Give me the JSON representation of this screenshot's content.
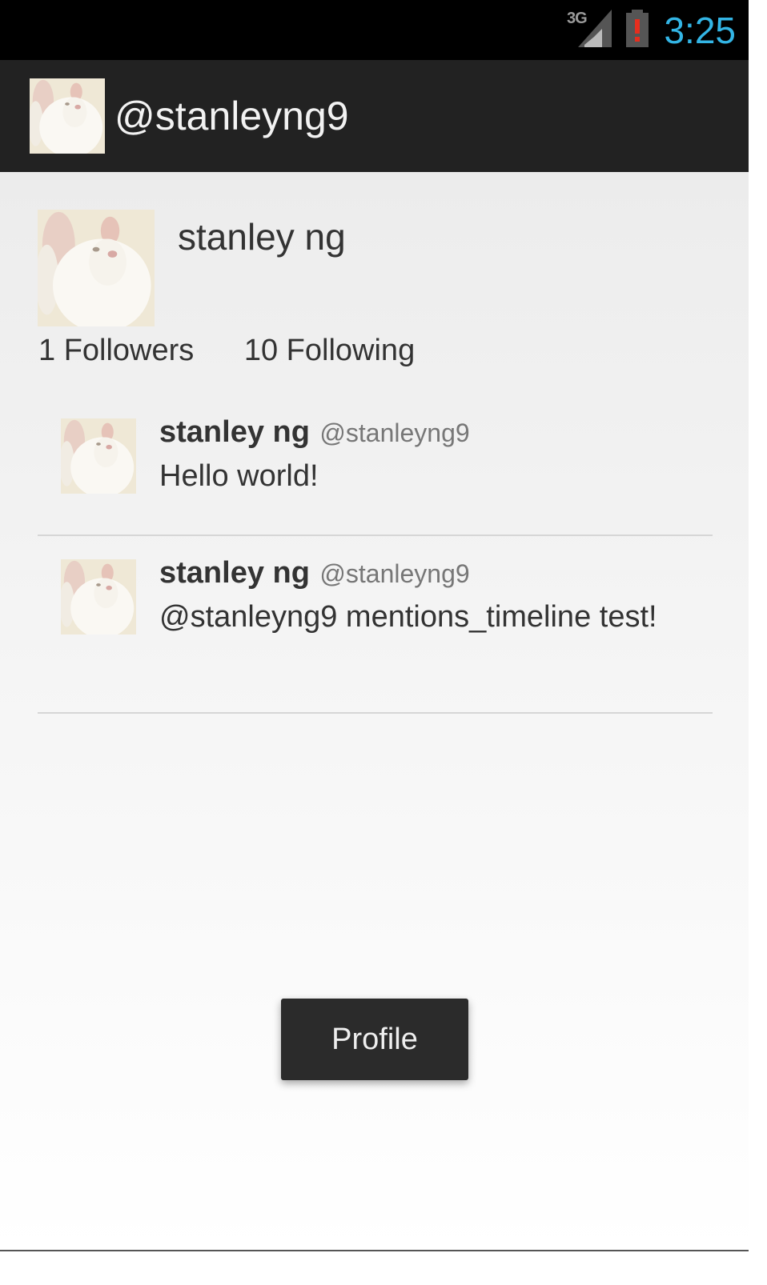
{
  "status_bar": {
    "network": "3G",
    "time": "3:25",
    "icons": [
      "signal-icon",
      "battery-alert-icon"
    ],
    "clock_color": "#33b5e5"
  },
  "action_bar": {
    "title": "@stanleyng9",
    "icon": "rabbit-avatar-icon"
  },
  "profile": {
    "name": "stanley ng",
    "followers": "1 Followers",
    "following": "10 Following"
  },
  "tweets": [
    {
      "name": "stanley ng",
      "handle": "@stanleyng9",
      "text": "Hello world!"
    },
    {
      "name": "stanley ng",
      "handle": "@stanleyng9",
      "text": "@stanleyng9 mentions_timeline test!"
    }
  ],
  "toast": {
    "text": "Profile"
  }
}
